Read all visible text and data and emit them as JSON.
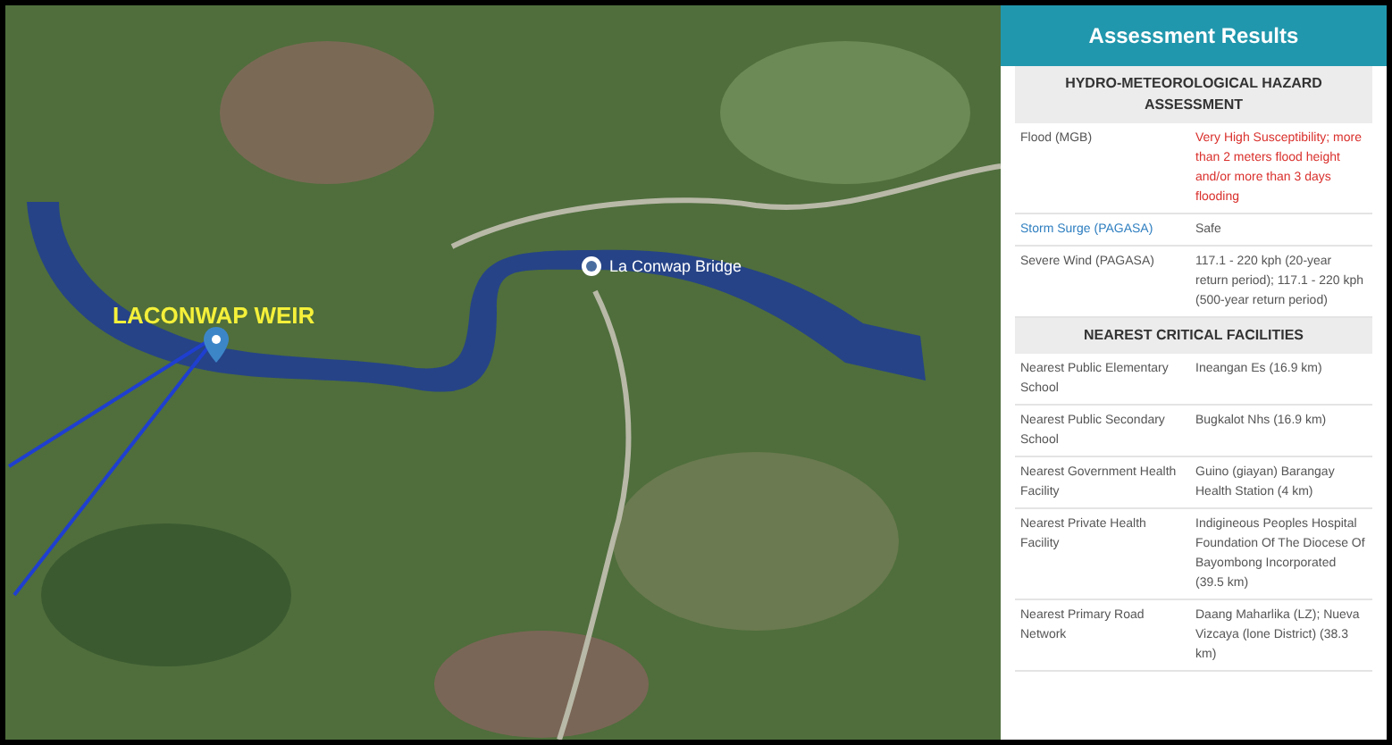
{
  "map": {
    "site_label": "LACONWAP WEIR",
    "bridge_label": "La Conwap Bridge"
  },
  "panel": {
    "title": "Assessment Results",
    "sections": [
      {
        "heading": "HYDRO-METEOROLOGICAL HAZARD ASSESSMENT",
        "rows": [
          {
            "label": "Flood (MGB)",
            "value": "Very High Susceptibility; more than 2 meters flood height and/or more than 3 days flooding",
            "label_link": false,
            "value_alert": true
          },
          {
            "label": "Storm Surge (PAGASA)",
            "value": "Safe",
            "label_link": true,
            "value_alert": false
          },
          {
            "label": "Severe Wind (PAGASA)",
            "value": "117.1 - 220 kph (20-year return period); 117.1 - 220 kph (500-year return period)",
            "label_link": false,
            "value_alert": false
          }
        ]
      },
      {
        "heading": "NEAREST CRITICAL FACILITIES",
        "rows": [
          {
            "label": "Nearest Public Elementary School",
            "value": "Ineangan Es (16.9 km)",
            "label_link": false,
            "value_alert": false
          },
          {
            "label": "Nearest Public Secondary School",
            "value": "Bugkalot Nhs (16.9 km)",
            "label_link": false,
            "value_alert": false
          },
          {
            "label": "Nearest Government Health Facility",
            "value": "Guino (giayan) Barangay Health Station (4 km)",
            "label_link": false,
            "value_alert": false
          },
          {
            "label": "Nearest Private Health Facility",
            "value": "Indigineous Peoples Hospital Foundation Of The Diocese Of Bayombong Incorporated (39.5 km)",
            "label_link": false,
            "value_alert": false
          },
          {
            "label": "Nearest Primary Road Network",
            "value": "Daang Maharlika (LZ); Nueva Vizcaya (lone District) (38.3 km)",
            "label_link": false,
            "value_alert": false
          }
        ]
      }
    ]
  }
}
